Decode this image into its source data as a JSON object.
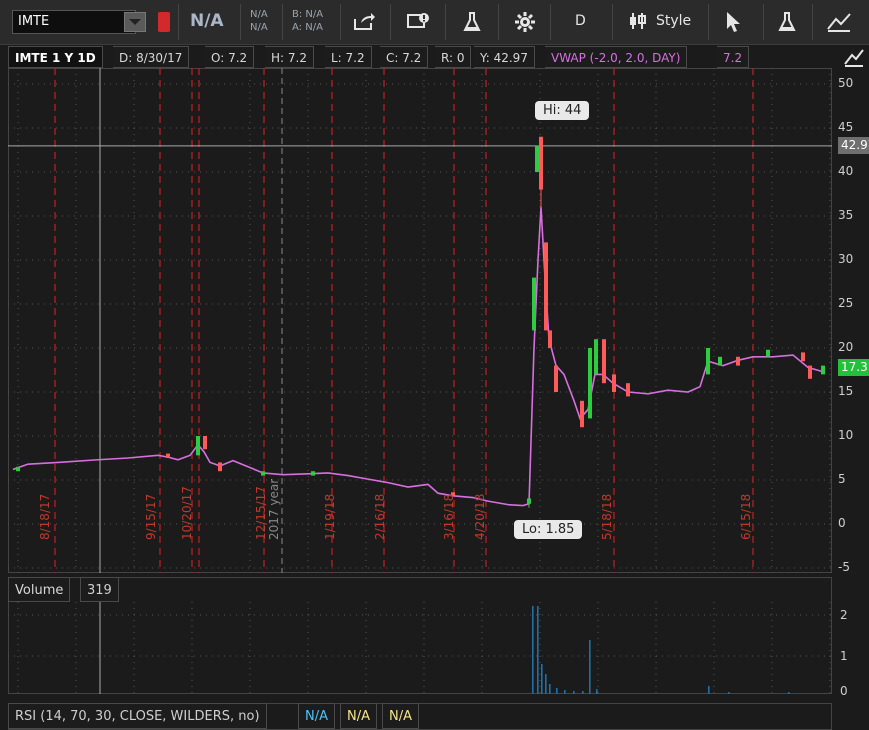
{
  "toolbar": {
    "symbol": "IMTE",
    "last": "N/A",
    "net_change_1": "N/A",
    "net_change_2": "N/A",
    "bid": "B: N/A",
    "ask": "A: N/A",
    "aggregation": "D",
    "style_label": "Style",
    "icons": [
      "share-icon",
      "tv-alert-icon",
      "flask-icon",
      "gear-icon",
      "candle-icon",
      "cursor-icon",
      "flask-icon-2",
      "drawing-icon"
    ]
  },
  "infobar": {
    "symbol_label": "IMTE 1 Y 1D",
    "date": "D: 8/30/17",
    "open": "O: 7.2",
    "high": "H: 7.2",
    "low": "L: 7.2",
    "close": "C: 7.2",
    "range": "R: 0",
    "y": "Y: 42.97",
    "vwap": "VWAP (-2.0, 2.0, DAY)",
    "vwap_value": "7.2"
  },
  "price_axis": [
    "50",
    "45",
    "40",
    "35",
    "30",
    "25",
    "20",
    "15",
    "10",
    "5",
    "0",
    "-5"
  ],
  "price_tags": {
    "crosshair": "42.97",
    "last": "17.3"
  },
  "callouts": {
    "hi": "Hi: 44",
    "lo": "Lo: 1.85"
  },
  "dates": [
    "8/18/17",
    "9/15/17",
    "10/20/17",
    "12/15/17",
    "2017 year",
    "1/19/18",
    "2/16/18",
    "3/16/18",
    "4/20/18",
    "5/18/18",
    "6/15/18"
  ],
  "volume": {
    "label": "Volume",
    "value": "319",
    "axis": [
      "2",
      "1",
      "0"
    ]
  },
  "rsi": {
    "label": "RSI (14, 70, 30, CLOSE, WILDERS, no)",
    "v1": "N/A",
    "v2": "N/A",
    "v3": "N/A"
  },
  "colors": {
    "up": "#2ecc40",
    "down": "#ff5a5a",
    "vwap": "#d86fe0",
    "volume": "#1f6fa8",
    "grid_red": "#b22222"
  },
  "chart_data": {
    "type": "candlestick",
    "ylim": [
      -5,
      50
    ],
    "x": [
      "8/18/17",
      "9/15/17",
      "10/20/17",
      "12/15/17",
      "1/19/18",
      "2/16/18",
      "3/16/18",
      "4/20/18",
      "5/18/18",
      "6/15/18"
    ],
    "price_close": [
      6.5,
      7.2,
      7.8,
      6.0,
      5.5,
      4.5,
      3.0,
      2.0,
      16.0,
      17.3
    ],
    "hi": 44,
    "lo": 1.85
  }
}
